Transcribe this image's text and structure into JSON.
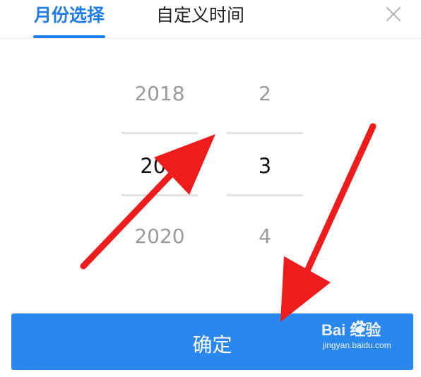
{
  "tabs": {
    "month_select": "月份选择",
    "custom_time": "自定义时间"
  },
  "picker": {
    "year": {
      "prev": "2018",
      "selected": "201",
      "next": "2020"
    },
    "month": {
      "prev": "2",
      "selected": "3",
      "next": "4"
    }
  },
  "confirm_label": "确定",
  "watermark": {
    "brand": "Bai  经验",
    "url": "jingyan.baidu.com"
  },
  "colors": {
    "accent": "#1f7ce8",
    "button": "#2a87ee",
    "arrow": "#ee1c1c"
  }
}
